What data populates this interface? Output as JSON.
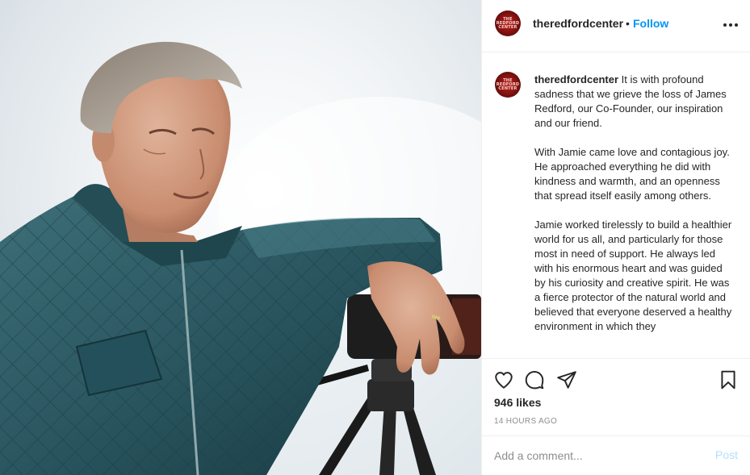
{
  "profile": {
    "username": "theredfordcenter",
    "separator": "•",
    "follow_label": "Follow",
    "avatar_text": "THE REDFORD CENTER",
    "brand_color": "#b01c18"
  },
  "caption": {
    "username": "theredfordcenter",
    "paragraphs": [
      "It is with profound sadness that we grieve the loss of James Redford, our Co-Founder, our inspiration and our friend.",
      "With Jamie came love and contagious joy. He approached everything he did with kindness and warmth, and an openness that spread itself easily among others.",
      "Jamie worked tirelessly to build a healthier world for us all, and particularly for those most in need of support. He always led with his enormous heart and was guided by his curiosity and creative spirit. He was a fierce protector of the natural world and believed that everyone deserved a healthy environment in which they"
    ]
  },
  "actions": {
    "icons": [
      "heart-icon",
      "comment-icon",
      "share-icon",
      "bookmark-icon"
    ]
  },
  "stats": {
    "likes": "946 likes",
    "timestamp": "14 HOURS AGO"
  },
  "comment": {
    "placeholder": "Add a comment...",
    "post_label": "Post",
    "post_color": "#b2dffc",
    "link_color": "#0095f6"
  }
}
